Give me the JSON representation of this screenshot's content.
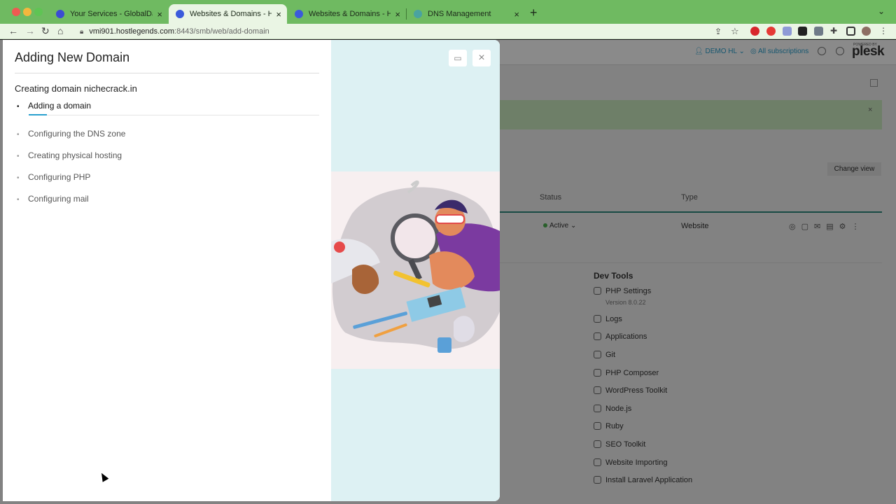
{
  "browser": {
    "tabs": [
      {
        "title": "Your Services - GlobalDash",
        "active": false,
        "favicon_color": "#3b4bd4"
      },
      {
        "title": "Websites & Domains - HostLegends",
        "active": true,
        "favicon_color": "#3b5bdb"
      },
      {
        "title": "Websites & Domains - HostLegends",
        "active": false,
        "favicon_color": "#3b5bdb"
      },
      {
        "title": "DNS Management",
        "active": false,
        "favicon_color": "#4aa3a0"
      }
    ],
    "close_glyph": "×",
    "new_tab_glyph": "+",
    "url_host": "vmi901.hostlegends.com",
    "url_path": ":8443/smb/web/add-domain"
  },
  "plesk_bg": {
    "user_label": "DEMO HL",
    "subscriptions_label": "All subscriptions",
    "logo": "plesk",
    "logo_tagline": "POWERED BY",
    "change_view_label": "Change view",
    "columns": [
      "Status",
      "Type"
    ],
    "row": {
      "status": "Active",
      "type": "Website"
    },
    "dev_tools_title": "Dev Tools",
    "php_version": "Version 8.0.22",
    "dev_tools": [
      "PHP Settings",
      "Logs",
      "Applications",
      "Git",
      "PHP Composer",
      "WordPress Toolkit",
      "Node.js",
      "Ruby",
      "SEO Toolkit",
      "Website Importing",
      "Install Laravel Application"
    ]
  },
  "modal": {
    "title": "Adding New Domain",
    "subtitle": "Creating domain nichecrack.in",
    "steps": [
      {
        "label": "Adding a domain",
        "state": "in-progress"
      },
      {
        "label": "Configuring the DNS zone",
        "state": "pending"
      },
      {
        "label": "Creating physical hosting",
        "state": "pending"
      },
      {
        "label": "Configuring PHP",
        "state": "pending"
      },
      {
        "label": "Configuring mail",
        "state": "pending"
      }
    ],
    "bullet": "•",
    "close_glyph": "×",
    "minimize_glyph": "▭"
  },
  "colors": {
    "accent": "#28a0ce",
    "chrome_green": "#6fba61",
    "illustration_panel": "#ddf1f3"
  }
}
